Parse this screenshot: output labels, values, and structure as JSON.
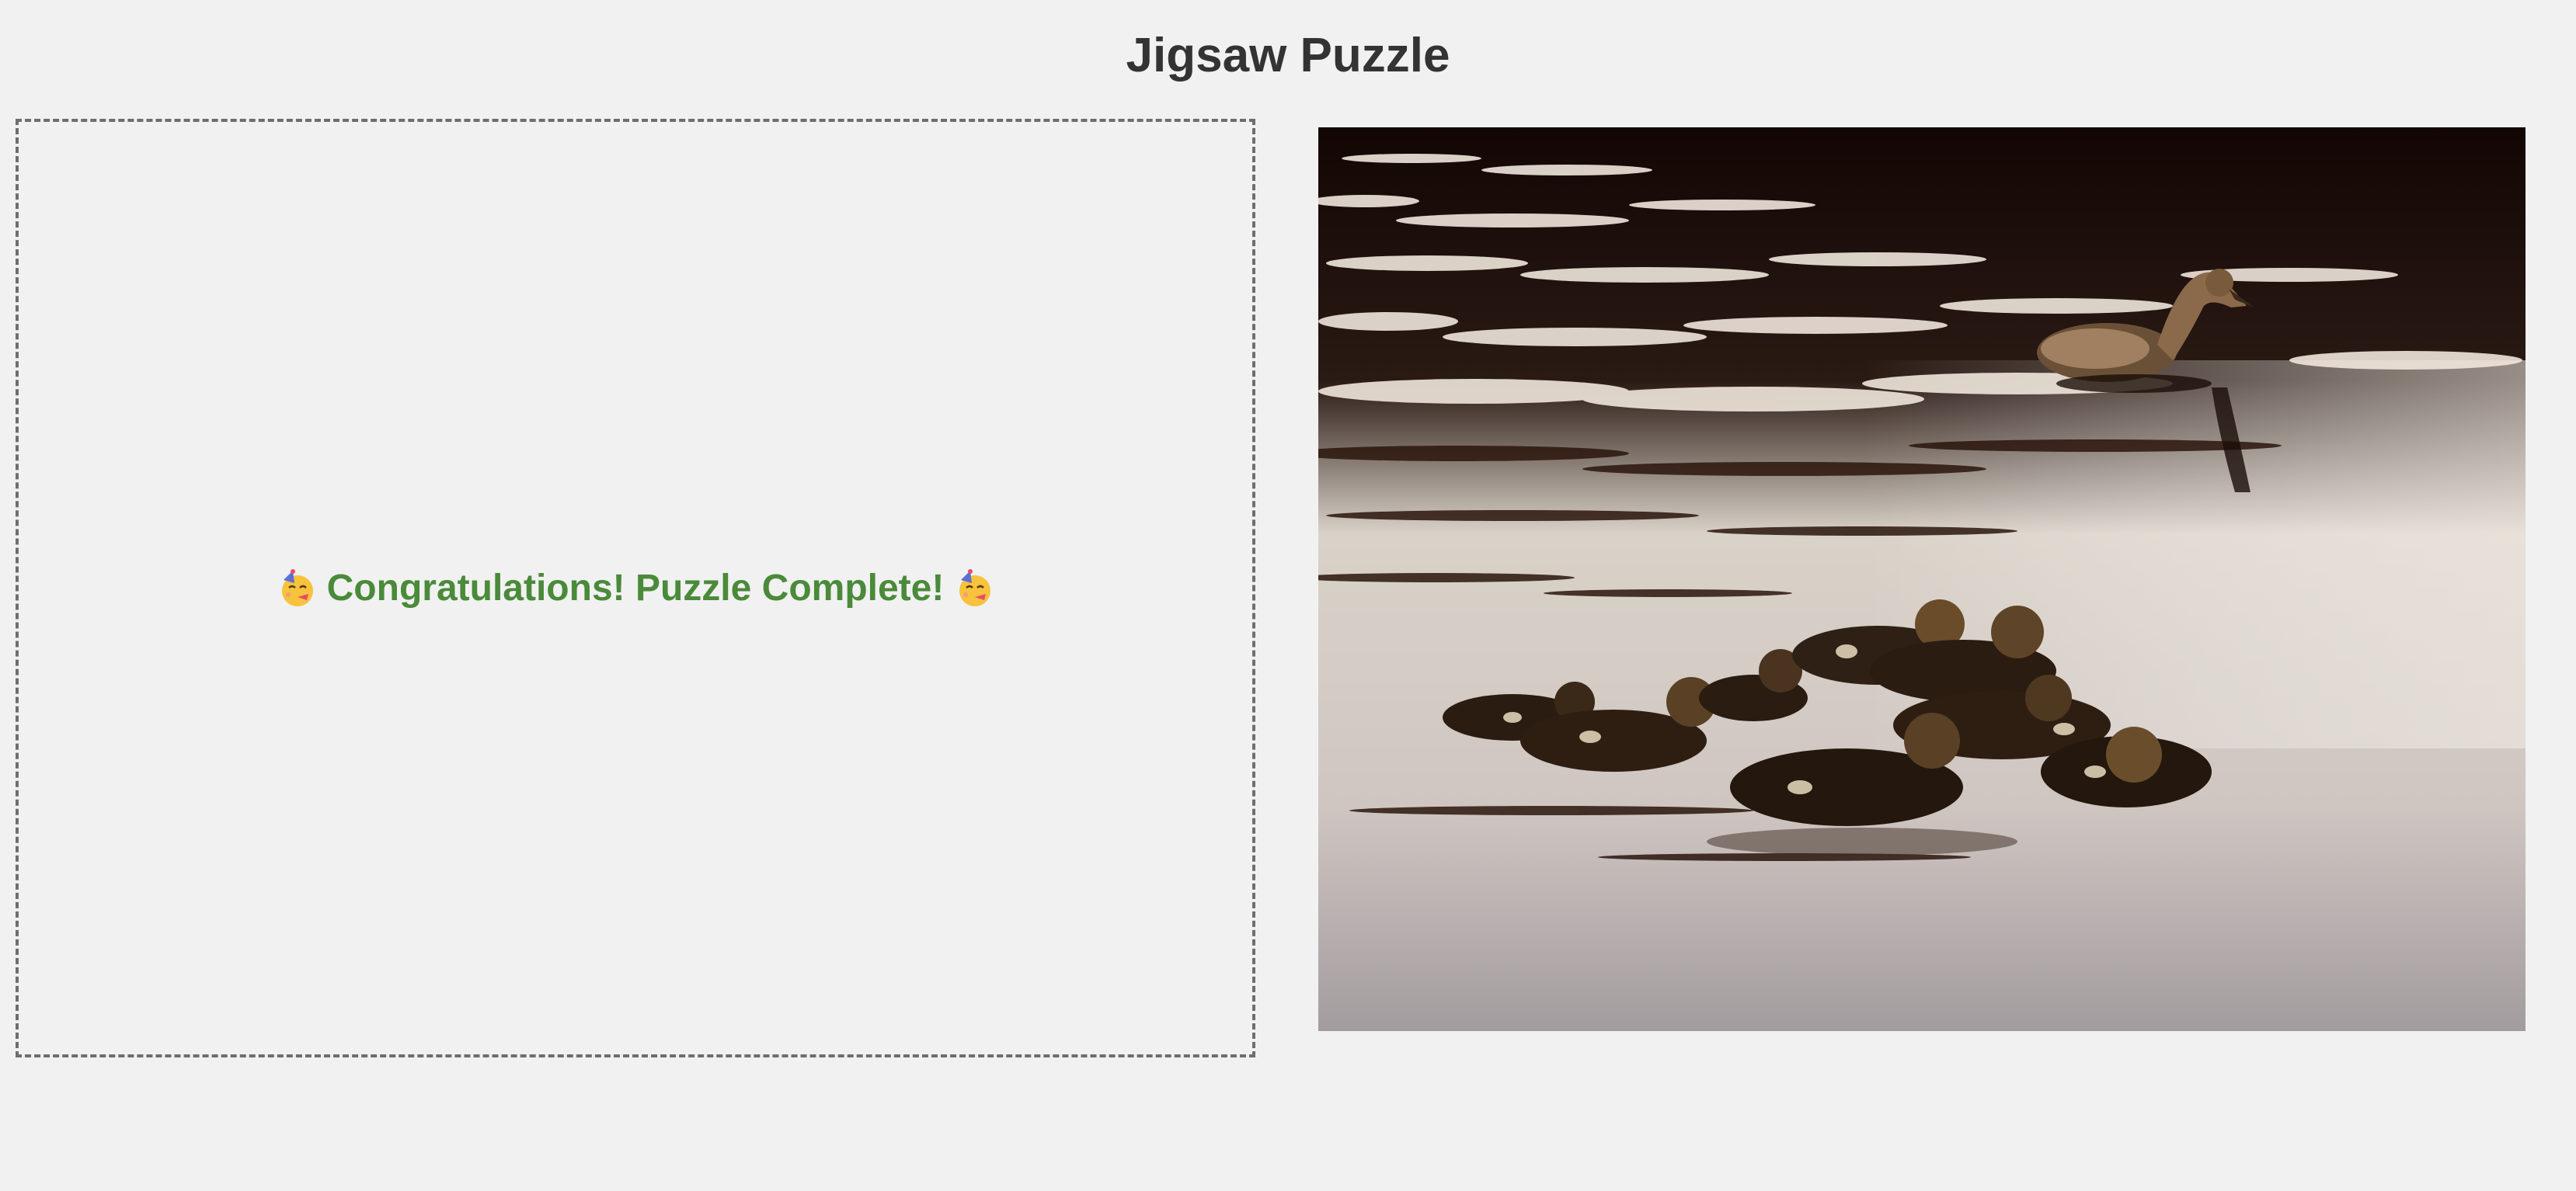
{
  "header": {
    "title": "Jigsaw Puzzle"
  },
  "board": {
    "message_text": "Congratulations! Puzzle Complete!",
    "message_color": "#4a8a3a",
    "left_icon": "partying-face-icon",
    "right_icon": "partying-face-icon"
  },
  "reference": {
    "icon": "completed-image-ducks",
    "subject": "duck with ducklings swimming"
  },
  "colors": {
    "background": "#f1f1f1",
    "title": "#333333",
    "border": "#6e6e6e"
  }
}
